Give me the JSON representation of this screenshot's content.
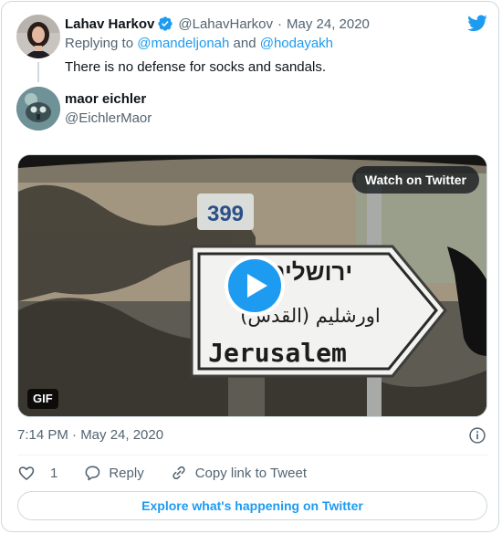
{
  "parent_tweet": {
    "author_name": "Lahav Harkov",
    "handle": "@LahavHarkov",
    "separator": "·",
    "date": "May 24, 2020",
    "reply_prefix": "Replying to",
    "reply_user_1": "@mandeljonah",
    "reply_and": "and",
    "reply_user_2": "@hodayakh",
    "text": "There is no defense for socks and sandals."
  },
  "main_tweet": {
    "author_name": "maor eichler",
    "handle": "@EichlerMaor",
    "media": {
      "watch_label": "Watch on Twitter",
      "gif_label": "GIF",
      "sign_text": "Jerusalem",
      "sign_hebrew": "ירושלים",
      "sign_arabic": "اورشليم (القدس)",
      "road_number": "399"
    },
    "timestamp": "7:14 PM · May 24, 2020",
    "actions": {
      "like_count": "1",
      "reply_label": "Reply",
      "copy_label": "Copy link to Tweet"
    },
    "explore_label": "Explore what's happening on Twitter"
  },
  "colors": {
    "accent": "#1d9bf0",
    "muted": "#536471",
    "border": "#cfd9de"
  },
  "icons": [
    "verified-badge-icon",
    "twitter-bird-icon",
    "info-icon",
    "heart-icon",
    "reply-icon",
    "link-icon",
    "play-icon"
  ]
}
